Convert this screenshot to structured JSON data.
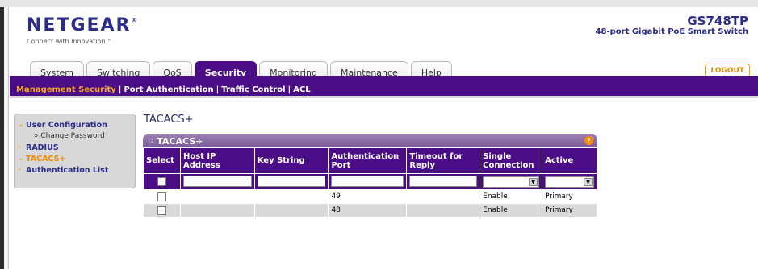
{
  "header": {
    "logo": "NETGEAR",
    "logo_mark": "®",
    "tagline": "Connect with Innovation™",
    "model": "GS748TP",
    "model_desc": "48-port Gigabit PoE Smart Switch",
    "logout": "LOGOUT"
  },
  "tabs": [
    "System",
    "Switching",
    "QoS",
    "Security",
    "Monitoring",
    "Maintenance",
    "Help"
  ],
  "active_tab": "Security",
  "subnav": [
    "Management Security",
    "Port Authentication",
    "Traffic Control",
    "ACL"
  ],
  "sidebar": {
    "items": [
      {
        "label": "User Configuration"
      },
      {
        "label": "» Change Password"
      },
      {
        "label": "RADIUS"
      },
      {
        "label": "TACACS+"
      },
      {
        "label": "Authentication List"
      }
    ]
  },
  "main": {
    "page_title": "TACACS+",
    "panel_title": "TACACS+",
    "help_label": "?",
    "columns": [
      "Select",
      "Host IP Address",
      "Key String",
      "Authentication Port",
      "Timeout for Reply",
      "Single Connection",
      "Active"
    ],
    "rows": [
      {
        "host": "",
        "key": "",
        "port": "49",
        "timeout": "",
        "single": "Enable",
        "active": "Primary"
      },
      {
        "host": "",
        "key": "",
        "port": "48",
        "timeout": "",
        "single": "Enable",
        "active": "Primary"
      }
    ]
  },
  "colors": {
    "purple": "#4b0d86",
    "orange": "#f08a00",
    "navy": "#2b2b8a"
  }
}
